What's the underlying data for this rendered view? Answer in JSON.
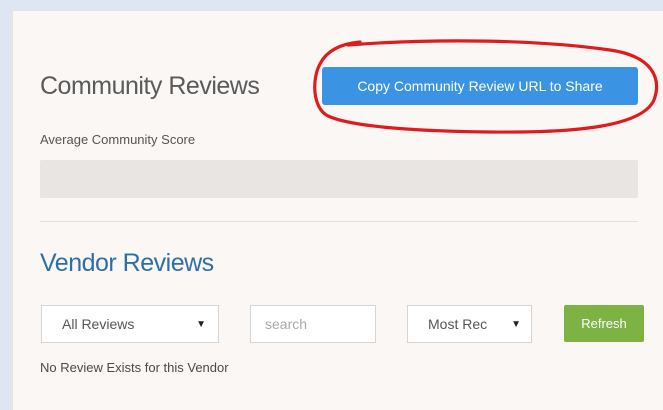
{
  "community": {
    "title": "Community Reviews",
    "copy_button_label": "Copy Community Review URL to Share",
    "average_score_label": "Average Community Score"
  },
  "vendor": {
    "title": "Vendor Reviews",
    "filter_selected": "All Reviews",
    "search_placeholder": "search",
    "sort_selected": "Most Rec",
    "refresh_label": "Refresh",
    "empty_message": "No Review Exists for this Vendor"
  },
  "colors": {
    "copy_button": "#3b93e4",
    "refresh_button": "#7cb342",
    "vendor_title": "#2f6fa9",
    "annotation": "#e01b1b"
  },
  "icons": {
    "dropdown": "caret-down-icon"
  }
}
